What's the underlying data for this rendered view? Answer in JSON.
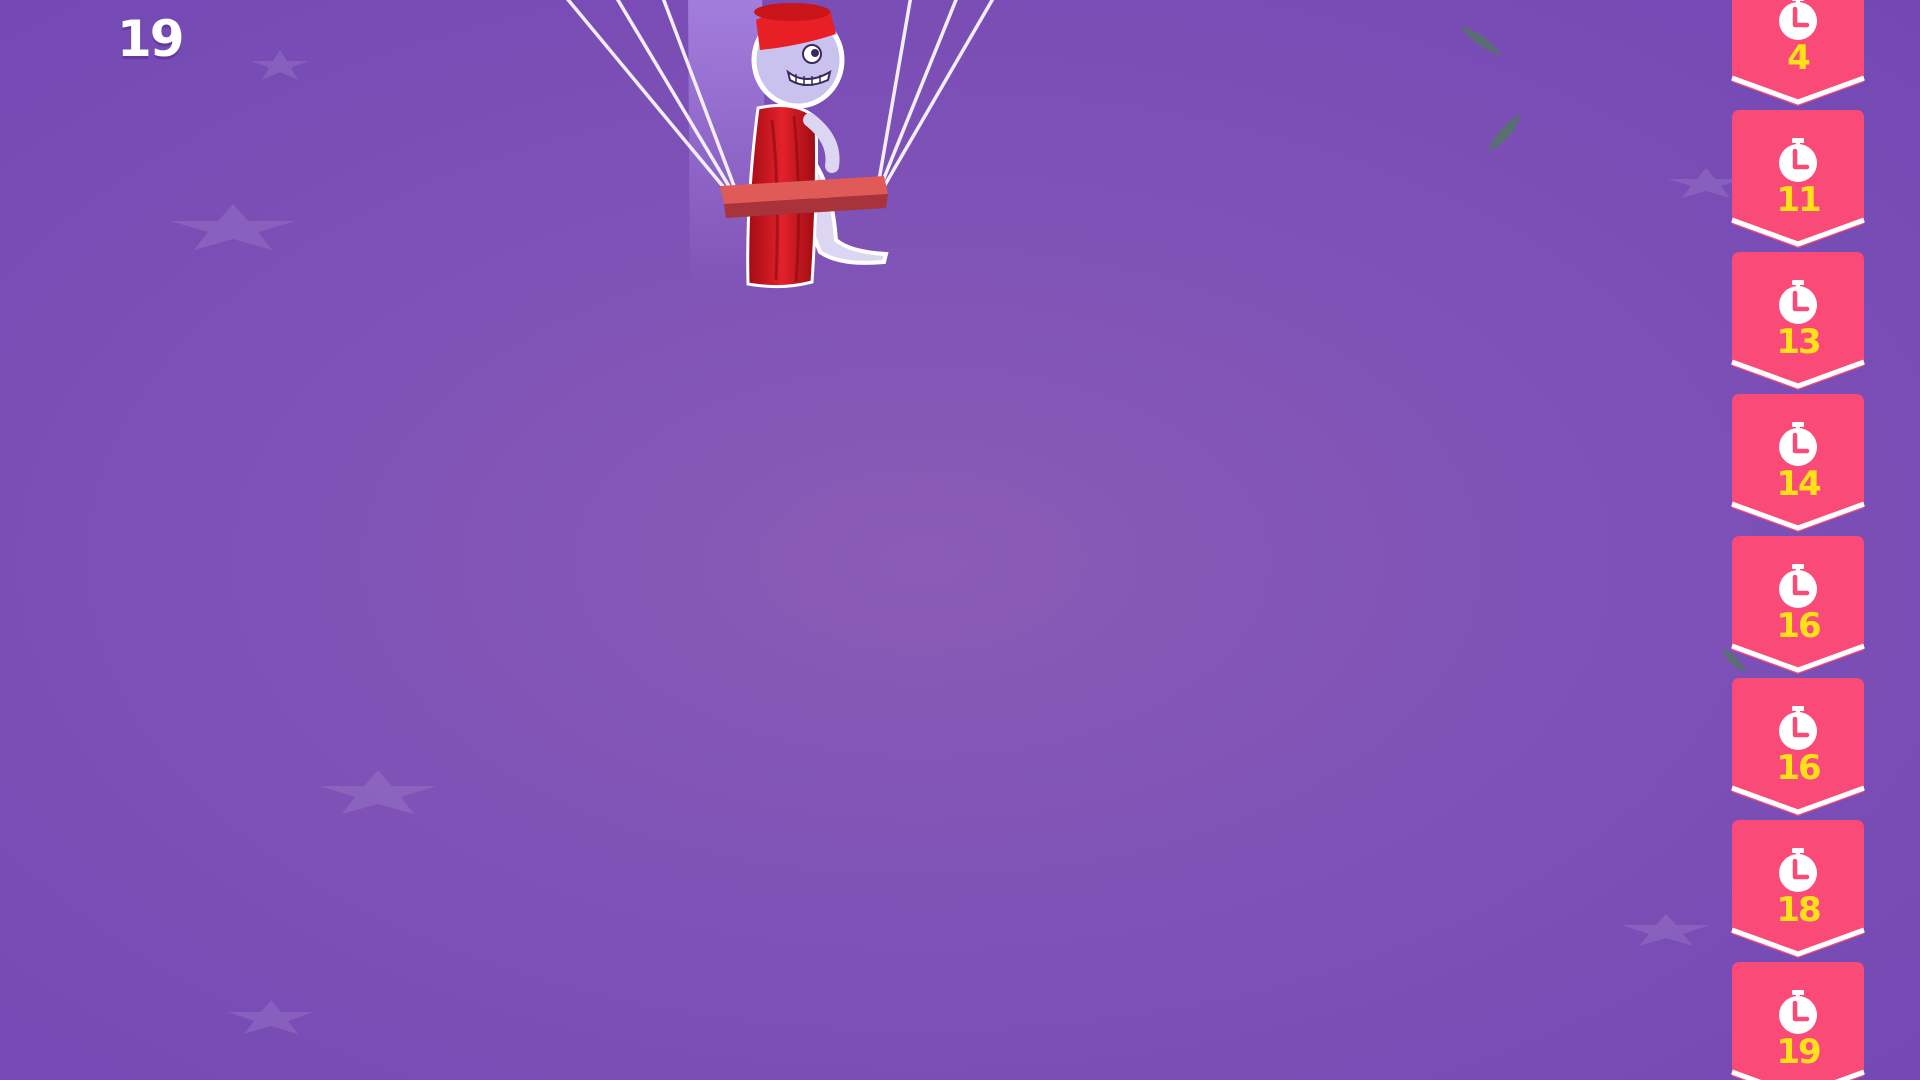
{
  "hud": {
    "score": "19"
  },
  "timer_badges": [
    {
      "value": "4",
      "icon": "stopwatch-icon"
    },
    {
      "value": "11",
      "icon": "stopwatch-icon"
    },
    {
      "value": "13",
      "icon": "stopwatch-icon"
    },
    {
      "value": "14",
      "icon": "stopwatch-icon"
    },
    {
      "value": "16",
      "icon": "stopwatch-icon"
    },
    {
      "value": "16",
      "icon": "stopwatch-icon"
    },
    {
      "value": "18",
      "icon": "stopwatch-icon"
    },
    {
      "value": "19",
      "icon": "stopwatch-icon"
    }
  ],
  "colors": {
    "background": "#7e52b6",
    "badge": "#fa4a78",
    "badge_value": "#ffe11a",
    "score_text": "#ffffff"
  }
}
